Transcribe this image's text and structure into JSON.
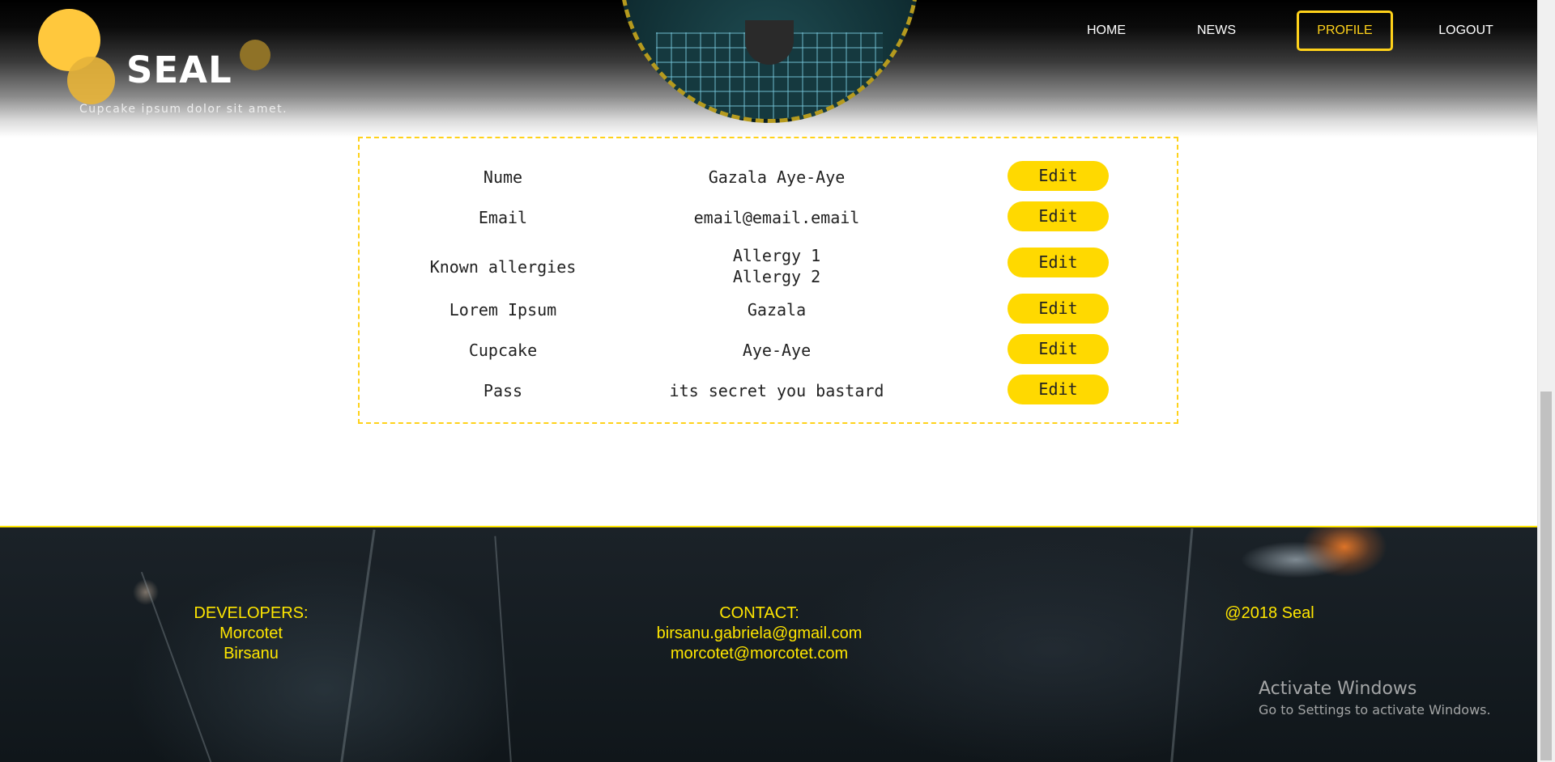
{
  "header": {
    "brand": "SEAL",
    "tagline": "Cupcake ipsum dolor sit amet.",
    "nav": [
      {
        "label": "HOME"
      },
      {
        "label": "NEWS"
      },
      {
        "label": "PROFILE",
        "active": true
      },
      {
        "label": "LOGOUT"
      }
    ]
  },
  "profile": {
    "rows": [
      {
        "label": "Nume",
        "value": [
          "Gazala Aye-Aye"
        ],
        "action": "Edit"
      },
      {
        "label": "Email",
        "value": [
          "email@email.email"
        ],
        "action": "Edit"
      },
      {
        "label": "Known allergies",
        "value": [
          "Allergy 1",
          "Allergy 2"
        ],
        "action": "Edit"
      },
      {
        "label": "Lorem Ipsum",
        "value": [
          "Gazala"
        ],
        "action": "Edit"
      },
      {
        "label": "Cupcake",
        "value": [
          "Aye-Aye"
        ],
        "action": "Edit"
      },
      {
        "label": "Pass",
        "value": [
          "its secret you bastard"
        ],
        "action": "Edit"
      }
    ]
  },
  "footer": {
    "developers": {
      "heading": "DEVELOPERS:",
      "names": [
        "Morcotet",
        "Birsanu"
      ]
    },
    "contact": {
      "heading": "CONTACT:",
      "emails": [
        "birsanu.gabriela@gmail.com",
        "morcotet@morcotet.com"
      ]
    },
    "copyright": "@2018 Seal"
  },
  "watermark": {
    "title": "Activate Windows",
    "subtitle": "Go to Settings to activate Windows."
  },
  "colors": {
    "accent": "#ffd900",
    "footer_text": "#ffe600",
    "footer_bg": "#141b20"
  }
}
